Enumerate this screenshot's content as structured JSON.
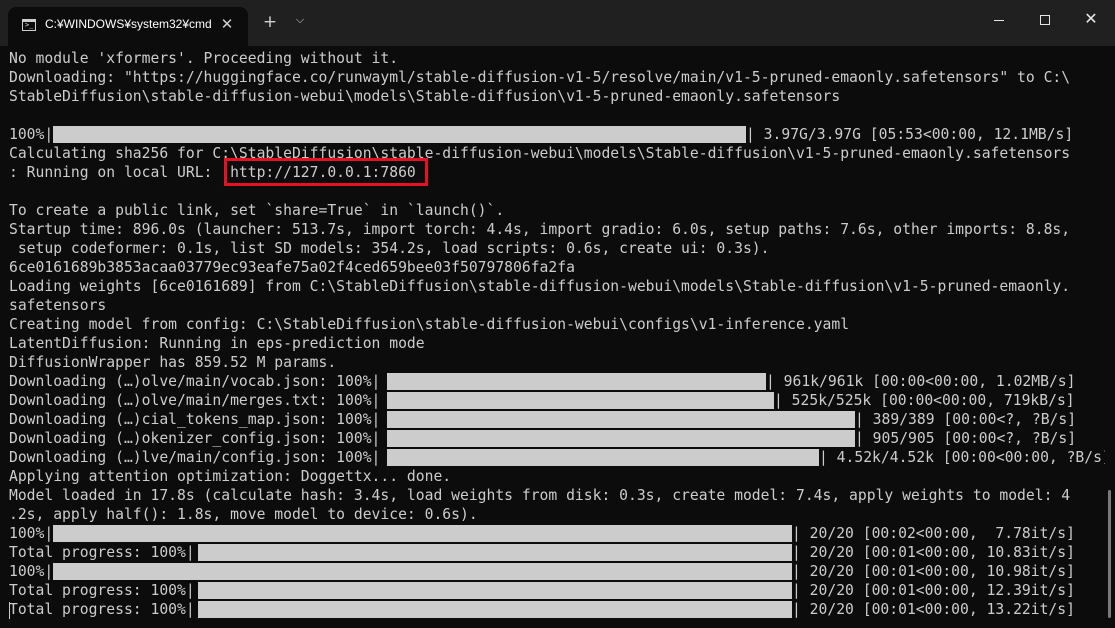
{
  "window": {
    "tab_title": "C:¥WINDOWS¥system32¥cmd",
    "tab_close": "✕",
    "new_tab": "+",
    "tab_dropdown": "⌵",
    "tab_icon_prompt": ">_",
    "close_glyph": "✕"
  },
  "terminal": {
    "lines": [
      "No module 'xformers'. Proceeding without it.",
      "Downloading: \"https://huggingface.co/runwayml/stable-diffusion-v1-5/resolve/main/v1-5-pruned-emaonly.safetensors\" to C:\\",
      "StableDiffusion\\stable-diffusion-webui\\models\\Stable-diffusion\\v1-5-pruned-emaonly.safetensors",
      "",
      "Calculating sha256 for C:\\StableDiffusion\\stable-diffusion-webui\\models\\Stable-diffusion\\v1-5-pruned-emaonly.safetensors",
      ": Running on local URL:  http://127.0.0.1:7860",
      "",
      "To create a public link, set `share=True` in `launch()`.",
      "Startup time: 896.0s (launcher: 513.7s, import torch: 4.4s, import gradio: 6.0s, setup paths: 7.6s, other imports: 8.8s,",
      " setup codeformer: 0.1s, list SD models: 354.2s, load scripts: 0.6s, create ui: 0.3s).",
      "6ce0161689b3853acaa03779ec93eafe75a02f4ced659bee03f50797806fa2fa",
      "Loading weights [6ce0161689] from C:\\StableDiffusion\\stable-diffusion-webui\\models\\Stable-diffusion\\v1-5-pruned-emaonly.",
      "safetensors",
      "Creating model from config: C:\\StableDiffusion\\stable-diffusion-webui\\configs\\v1-inference.yaml",
      "LatentDiffusion: Running in eps-prediction mode",
      "DiffusionWrapper has 859.52 M params.",
      "Applying attention optimization: Doggettx... done.",
      "Model loaded in 17.8s (calculate hash: 3.4s, load weights from disk: 0.3s, create model: 7.4s, apply weights to model: 4",
      ".2s, apply half(): 1.8s, move model to device: 0.6s)."
    ],
    "progress": [
      {
        "prefix": "100%|",
        "stats": "| 3.97G/3.97G [05:53<00:00, 12.1MB/s]",
        "percent": 100
      },
      {
        "prefix": "Downloading (…)olve/main/vocab.json: 100%|",
        "stats": "| 961k/961k [00:00<00:00, 1.02MB/s]",
        "percent": 100
      },
      {
        "prefix": "Downloading (…)olve/main/merges.txt: 100%|",
        "stats": "| 525k/525k [00:00<00:00, 719kB/s]",
        "percent": 100
      },
      {
        "prefix": "Downloading (…)cial_tokens_map.json: 100%|",
        "stats": "| 389/389 [00:00<?, ?B/s]",
        "percent": 100
      },
      {
        "prefix": "Downloading (…)okenizer_config.json: 100%|",
        "stats": "| 905/905 [00:00<?, ?B/s]",
        "percent": 100
      },
      {
        "prefix": "Downloading (…)lve/main/config.json: 100%|",
        "stats": "| 4.52k/4.52k [00:00<00:00, ?B/s]",
        "percent": 100
      },
      {
        "prefix": "100%|",
        "stats": "| 20/20 [00:02<00:00,  7.78it/s]",
        "percent": 100
      },
      {
        "prefix": "Total progress: 100%|",
        "stats": "| 20/20 [00:01<00:00, 10.83it/s]",
        "percent": 100
      },
      {
        "prefix": "100%|",
        "stats": "| 20/20 [00:01<00:00, 10.98it/s]",
        "percent": 100
      },
      {
        "prefix": "Total progress: 100%|",
        "stats": "| 20/20 [00:01<00:00, 12.39it/s]",
        "percent": 100
      },
      {
        "prefix": "Total progress: 100%|",
        "stats": "| 20/20 [00:01<00:00, 13.22it/s]",
        "percent": 100
      }
    ]
  },
  "colors": {
    "background": "#0c0c0c",
    "titlebar": "#202020",
    "text": "#cccccc",
    "highlight_box": "#e81123"
  },
  "icons": {
    "tab_icon": "cmd-terminal-icon",
    "minimize": "minimize-icon",
    "maximize": "maximize-icon",
    "close": "close-icon"
  }
}
